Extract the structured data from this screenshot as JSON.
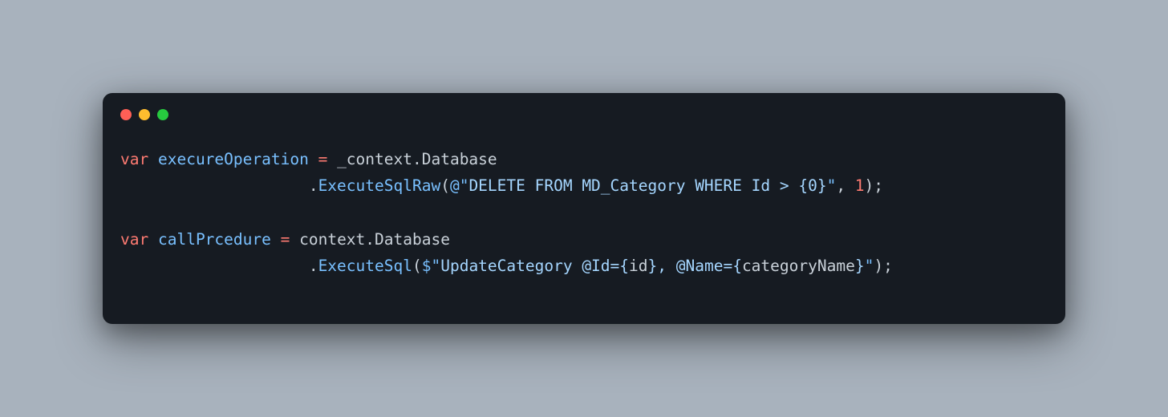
{
  "controls": {
    "red": "close",
    "yellow": "minimize",
    "green": "maximize"
  },
  "code": {
    "line1": {
      "kw": "var",
      "varName": "execureOperation",
      "eq": " = ",
      "obj": "_context",
      "dot1": ".",
      "prop": "Database"
    },
    "line2": {
      "indent": "                    ",
      "dot": ".",
      "method": "ExecuteSqlRaw",
      "open": "(",
      "at": "@",
      "q1": "\"",
      "str": "DELETE FROM MD_Category WHERE Id > {0}",
      "q2": "\"",
      "comma": ", ",
      "num": "1",
      "close": ");"
    },
    "line3": "",
    "line4": {
      "kw": "var",
      "varName": "callPrcedure",
      "eq": " = ",
      "obj": "context",
      "dot1": ".",
      "prop": "Database"
    },
    "line5": {
      "indent": "                    ",
      "dot": ".",
      "method": "ExecuteSql",
      "open": "(",
      "dollar": "$",
      "q1": "\"",
      "strPart1": "UpdateCategory @Id=",
      "interpOpen1": "{",
      "interpVar1": "id",
      "interpClose1": "}",
      "strPart2": ", @Name=",
      "interpOpen2": "{",
      "interpVar2": "categoryName",
      "interpClose2": "}",
      "q2": "\"",
      "close": ");"
    }
  }
}
